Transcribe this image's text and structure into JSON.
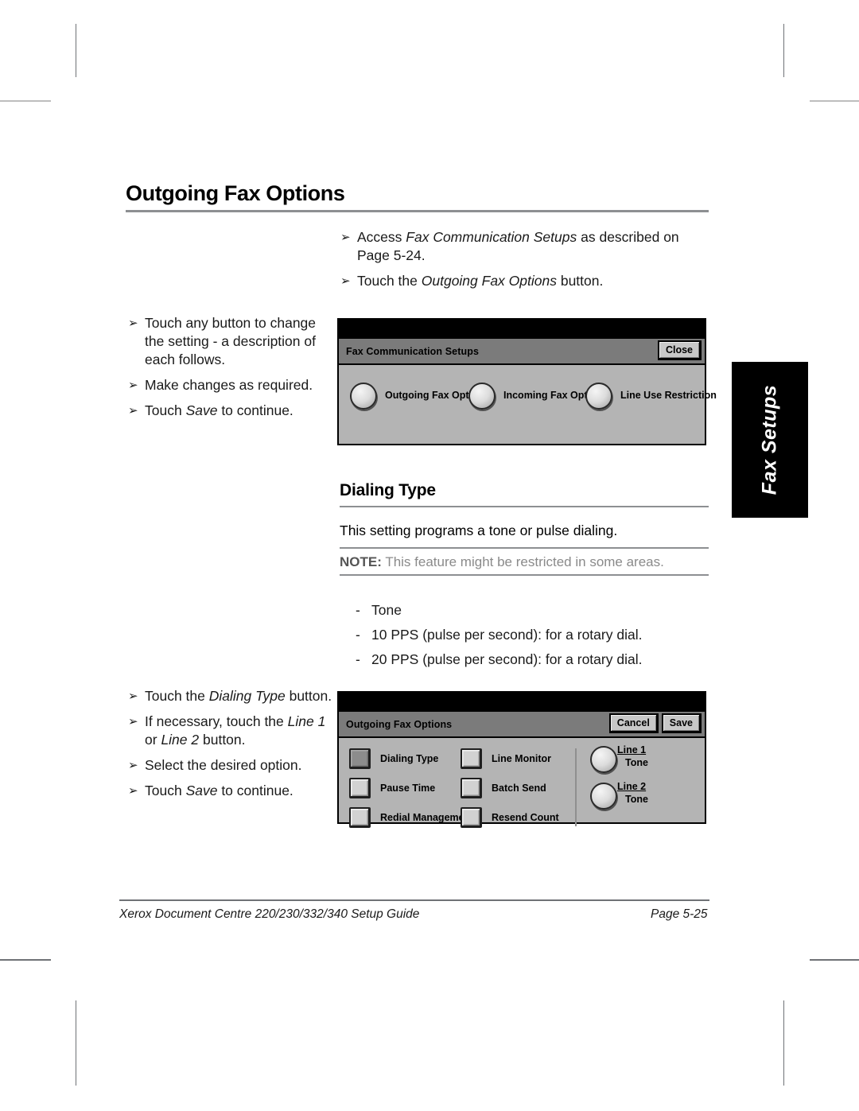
{
  "page": {
    "heading": "Outgoing Fax Options",
    "subheading": "Dialing Type",
    "side_tab": "Fax Setups",
    "lead_text": "This setting programs a tone or pulse dialing.",
    "note_label": "NOTE:",
    "note_text": "This feature might be restricted in some areas.",
    "footer_left": "Xerox Document Centre 220/230/332/340 Setup Guide",
    "footer_right": "Page 5-25"
  },
  "intro_steps": [
    {
      "chevron": "➢",
      "text": "Access ",
      "em1": "Fax Communication Setups",
      "text2": " as described on Page 5-24."
    },
    {
      "chevron": "➢",
      "text": "Touch the ",
      "em1": "Outgoing Fax Options",
      "text2": " button."
    }
  ],
  "steps_left_1": [
    {
      "chevron": "➢",
      "text": "Touch any button to change the setting - a description of each follows."
    },
    {
      "chevron": "➢",
      "text": "Make changes as required."
    },
    {
      "chevron": "➢",
      "text2_pre": "Touch ",
      "em": "Save",
      "text2_post": " to continue."
    }
  ],
  "steps_left_2": [
    {
      "chevron": "➢",
      "pre": "Touch the ",
      "em": "Dialing Type",
      "post": " button."
    },
    {
      "chevron": "➢",
      "pre": "If necessary, touch the ",
      "em": "Line 1",
      "mid": " or ",
      "em2": "Line 2",
      "post": " button."
    },
    {
      "chevron": "➢",
      "pre": "Select the desired option."
    },
    {
      "chevron": "➢",
      "pre": "Touch ",
      "em": "Save",
      "post": " to continue."
    }
  ],
  "dial_options": [
    {
      "dash": "-",
      "text": "Tone"
    },
    {
      "dash": "-",
      "text": "10 PPS (pulse per second): for a rotary dial."
    },
    {
      "dash": "-",
      "text": "20 PPS (pulse per second): for a rotary dial."
    }
  ],
  "panel1": {
    "title": "Fax Communication Setups",
    "close_label": "Close",
    "buttons": [
      {
        "label": "Outgoing Fax Options"
      },
      {
        "label": "Incoming Fax Options"
      },
      {
        "label": "Line Use Restriction"
      }
    ]
  },
  "panel2": {
    "title": "Outgoing Fax Options",
    "cancel_label": "Cancel",
    "save_label": "Save",
    "col1": [
      {
        "label": "Dialing Type",
        "selected": true
      },
      {
        "label": "Pause Time",
        "selected": false
      },
      {
        "label": "Redial Management",
        "selected": false
      }
    ],
    "col2": [
      {
        "label": "Line Monitor",
        "selected": false
      },
      {
        "label": "Batch Send",
        "selected": false
      },
      {
        "label": "Resend Count",
        "selected": false
      }
    ],
    "lines": [
      {
        "name": "Line 1",
        "value": "Tone"
      },
      {
        "name": "Line 2",
        "value": "Tone"
      }
    ]
  },
  "colors": {
    "rule": "#8d8f92",
    "panel_bg": "#b4b4b4",
    "titlebar": "#7b7b7b",
    "note_text": "#8a8a8a",
    "side_tab_bg": "#000000"
  }
}
